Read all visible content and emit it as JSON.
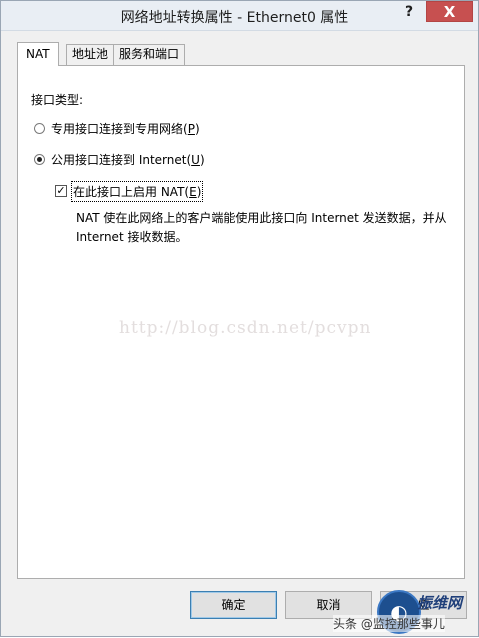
{
  "window": {
    "title": "网络地址转换属性 - Ethernet0 属性",
    "help_symbol": "?",
    "close_symbol": "X"
  },
  "tabs": [
    {
      "label": "NAT"
    },
    {
      "label": "地址池"
    },
    {
      "label": "服务和端口"
    }
  ],
  "nat": {
    "interface_type_label": "接口类型:",
    "private_option": {
      "label": "专用接口连接到专用网络(",
      "mnemonic": "P",
      "suffix": ")",
      "selected": false
    },
    "public_option": {
      "label": "公用接口连接到 Internet(",
      "mnemonic": "U",
      "suffix": ")",
      "selected": true
    },
    "enable_nat": {
      "label": "在此接口上启用 NAT(",
      "mnemonic": "E",
      "suffix": ")",
      "checked": true
    },
    "description_line1": "NAT 使在此网络上的客户端能使用此接口向 Internet 发送数据，并从",
    "description_line2": "Internet 接收数据。"
  },
  "watermark": "http://blog.csdn.net/pcvpn",
  "buttons": {
    "ok": "确定",
    "cancel": "取消",
    "apply_partial": "应"
  },
  "overlay": {
    "brand_name": "振维网",
    "footer_prefix": "头条 @",
    "footer_text": "监控那些事儿"
  }
}
